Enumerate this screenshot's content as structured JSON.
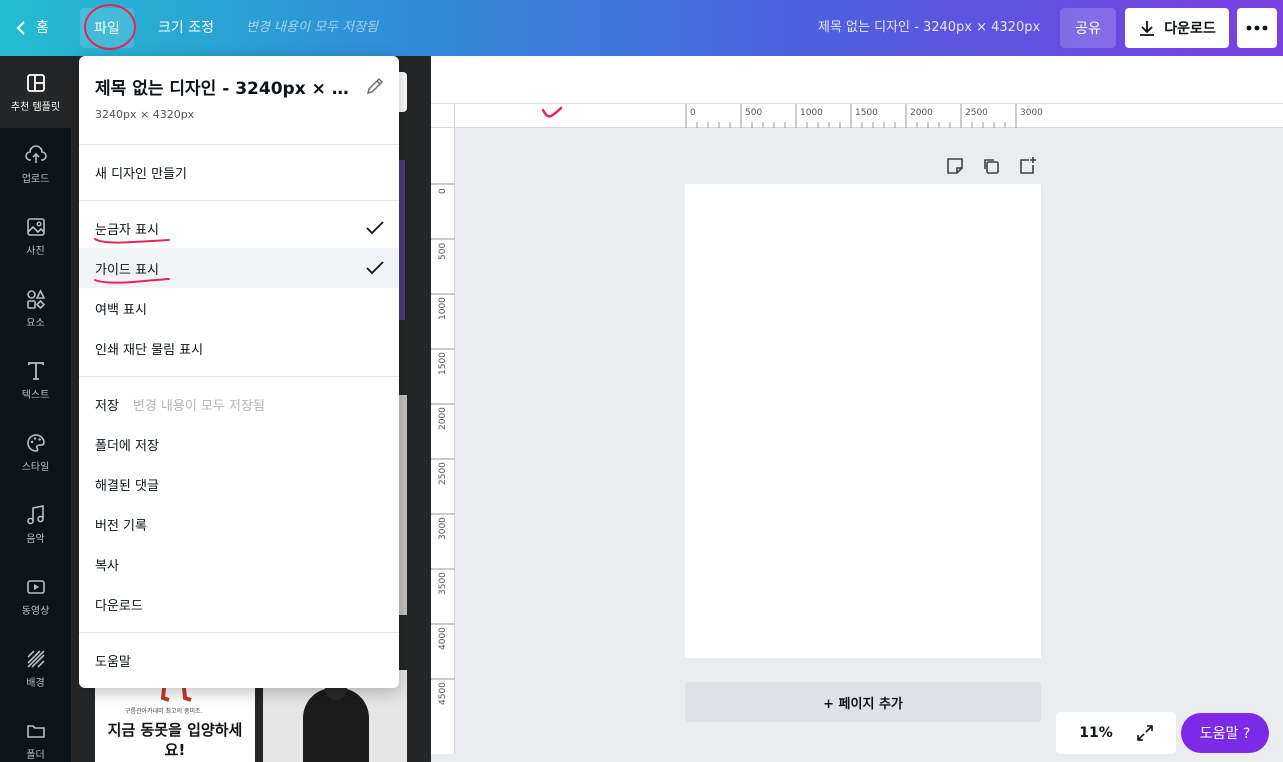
{
  "topbar": {
    "home_label": "홈",
    "file_label": "파일",
    "resize_label": "크기 조정",
    "saved_status": "변경 내용이 모두 저장됨",
    "doc_title": "제목 없는 디자인 - 3240px × 4320px",
    "share_label": "공유",
    "download_label": "다운로드"
  },
  "rail": {
    "items": [
      {
        "label": "추천 템플릿",
        "icon": "template-icon"
      },
      {
        "label": "업로드",
        "icon": "upload-cloud-icon"
      },
      {
        "label": "사진",
        "icon": "photo-icon"
      },
      {
        "label": "요소",
        "icon": "shapes-icon"
      },
      {
        "label": "텍스트",
        "icon": "text-icon"
      },
      {
        "label": "스타일",
        "icon": "palette-icon"
      },
      {
        "label": "음악",
        "icon": "music-icon"
      },
      {
        "label": "동영상",
        "icon": "video-icon"
      },
      {
        "label": "배경",
        "icon": "background-icon"
      },
      {
        "label": "폴더",
        "icon": "folder-icon"
      }
    ]
  },
  "menu": {
    "title": "제목 없는 디자인 - 3240px × 4320px",
    "subtitle": "3240px × 4320px",
    "new_design": "새 디자인 만들기",
    "show_rulers": "눈금자 표시",
    "show_guides": "가이드 표시",
    "show_margins": "여백 표시",
    "show_print_bleed": "인쇄 재단 물림 표시",
    "save": "저장",
    "save_status": "변경 내용이 모두 저장됨",
    "save_to_folder": "폴더에 저장",
    "resolved_comments": "해결된 댓글",
    "version_history": "버전 기록",
    "copy": "복사",
    "download": "다운로드",
    "help": "도움말"
  },
  "thumbs": {
    "t1_small": "구름관아카데미 최고의 중미조.",
    "t1_big": "지금 동못을 입양하세요!"
  },
  "ruler": {
    "h_labels": [
      "0",
      "500",
      "1000",
      "1500",
      "2000",
      "2500",
      "3000"
    ],
    "v_labels": [
      "0",
      "500",
      "1000",
      "1500",
      "2000",
      "2500",
      "3000",
      "3500",
      "4000",
      "4500"
    ]
  },
  "canvas": {
    "add_page": "+ 페이지 추가"
  },
  "footer": {
    "zoom": "11%",
    "help": "도움말 ?"
  },
  "colors": {
    "accent_purple": "#7d2ae8",
    "annotation_red": "#e8245c",
    "rail_bg": "#0e1318"
  }
}
